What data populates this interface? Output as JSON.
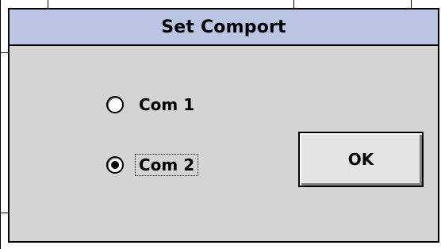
{
  "dialog": {
    "title": "Set Comport",
    "title_bar_color": "#b9c5e3",
    "background_color": "#d4d4d4"
  },
  "options": [
    {
      "label": "Com 1",
      "selected": false,
      "focused": false
    },
    {
      "label": "Com 2",
      "selected": true,
      "focused": true
    }
  ],
  "ok_button": {
    "label": "OK"
  }
}
